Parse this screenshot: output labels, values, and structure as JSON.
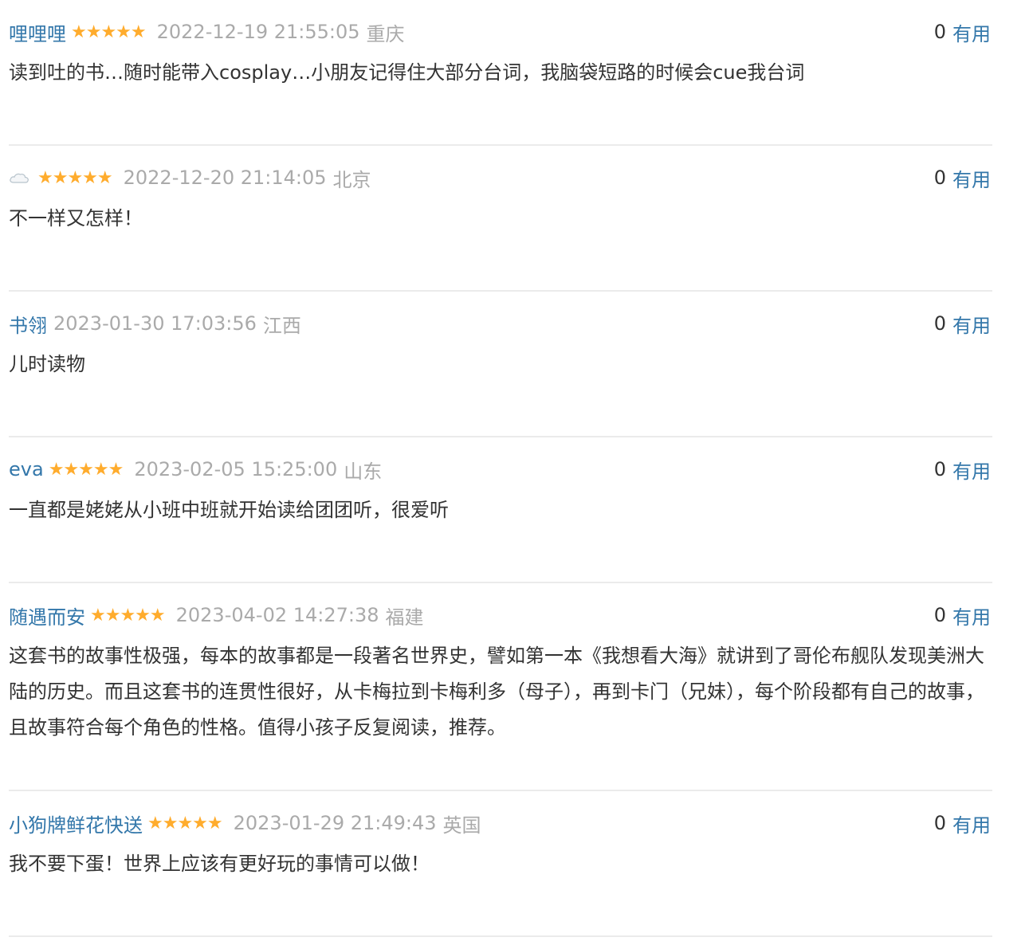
{
  "reviews": [
    {
      "user": "哩哩哩",
      "stars": "★★★★★",
      "time": "2022-12-19 21:55:05",
      "location": "重庆",
      "votes": "0",
      "useful_label": "有用",
      "content": "读到吐的书…随时能带入cosplay…小朋友记得住大部分台词，我脑袋短路的时候会cue我台词"
    },
    {
      "user": "",
      "user_icon": "cloud-icon",
      "stars": "★★★★★",
      "time": "2022-12-20 21:14:05",
      "location": "北京",
      "votes": "0",
      "useful_label": "有用",
      "content": "不一样又怎样！"
    },
    {
      "user": "书翎",
      "time": "2023-01-30 17:03:56",
      "location": "江西",
      "votes": "0",
      "useful_label": "有用",
      "content": "儿时读物"
    },
    {
      "user": "eva",
      "stars": "★★★★★",
      "time": "2023-02-05 15:25:00",
      "location": "山东",
      "votes": "0",
      "useful_label": "有用",
      "content": "一直都是姥姥从小班中班就开始读给团团听，很爱听"
    },
    {
      "user": "随遇而安",
      "stars": "★★★★★",
      "time": "2023-04-02 14:27:38",
      "location": "福建",
      "votes": "0",
      "useful_label": "有用",
      "content": "这套书的故事性极强，每本的故事都是一段著名世界史，譬如第一本《我想看大海》就讲到了哥伦布舰队发现美洲大陆的历史。而且这套书的连贯性很好，从卡梅拉到卡梅利多（母子），再到卡门（兄妹），每个阶段都有自己的故事，且故事符合每个角色的性格。值得小孩子反复阅读，推荐。"
    },
    {
      "user": "小狗牌鲜花快送",
      "stars": "★★★★★",
      "time": "2023-01-29 21:49:43",
      "location": "英国",
      "votes": "0",
      "useful_label": "有用",
      "content": "我不要下蛋！世界上应该有更好玩的事情可以做！"
    }
  ],
  "colors": {
    "link": "#3377aa",
    "star": "#ffac2d",
    "meta": "#aaaaaa",
    "text": "#333333",
    "divider": "#ebebeb"
  }
}
